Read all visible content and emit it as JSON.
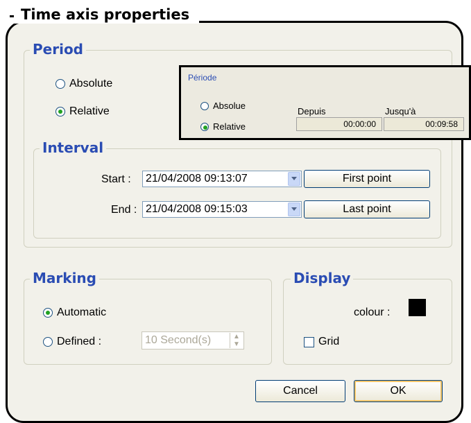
{
  "dialog": {
    "title": "Time axis properties"
  },
  "period": {
    "title": "Period",
    "absolute_label": "Absolute",
    "relative_label": "Relative",
    "selected": "relative"
  },
  "inset": {
    "title": "Période",
    "absolue_label": "Absolue",
    "relative_label": "Relative",
    "depuis_label": "Depuis",
    "jusqua_label": "Jusqu'à",
    "depuis_value": "00:00:00",
    "jusqua_value": "00:09:58"
  },
  "interval": {
    "title": "Interval",
    "start_label": "Start :",
    "start_value": "21/04/2008 09:13:07",
    "end_label": "End :",
    "end_value": "21/04/2008 09:15:03",
    "first_point_label": "First point",
    "last_point_label": "Last point"
  },
  "marking": {
    "title": "Marking",
    "automatic_label": "Automatic",
    "defined_label": "Defined :",
    "defined_value": "10 Second(s)",
    "selected": "automatic"
  },
  "display": {
    "title": "Display",
    "colour_label": "colour :",
    "colour_value": "#000000",
    "grid_label": "Grid",
    "grid_checked": false
  },
  "buttons": {
    "cancel_label": "Cancel",
    "ok_label": "OK"
  }
}
